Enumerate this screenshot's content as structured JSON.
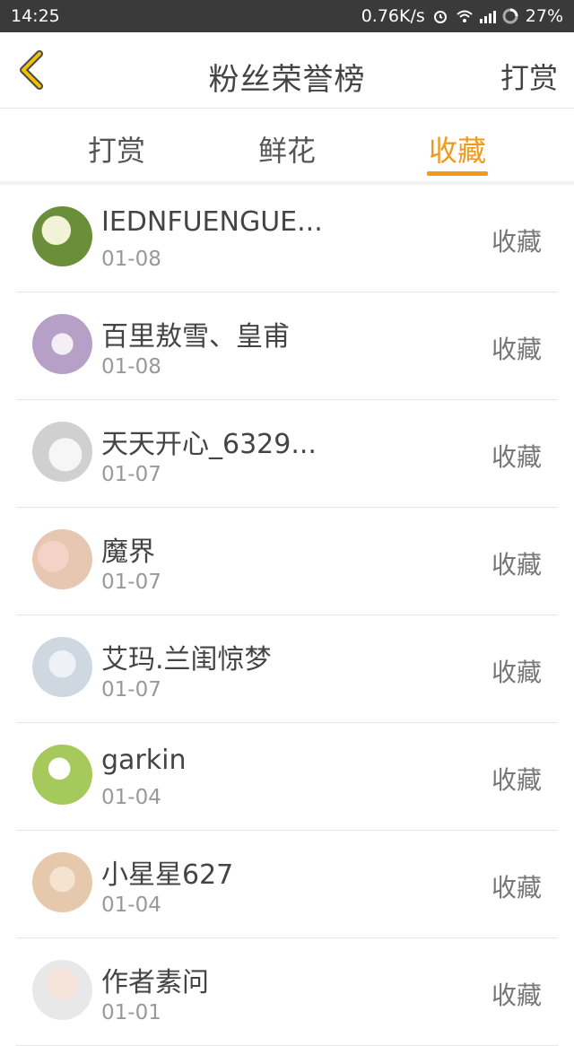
{
  "status": {
    "time": "14:25",
    "speed": "0.76K/s",
    "battery": "27%"
  },
  "header": {
    "title": "粉丝荣誉榜",
    "action": "打赏"
  },
  "tabs": [
    {
      "label": "打赏"
    },
    {
      "label": "鲜花"
    },
    {
      "label": "收藏"
    }
  ],
  "list": [
    {
      "name": "IEDNFUENGUE...",
      "date": "01-08",
      "tag": "收藏",
      "avatar_color": "#6b8e3a"
    },
    {
      "name": "百里敖雪、皇甫",
      "date": "01-08",
      "tag": "收藏",
      "avatar_color": "#b7a0c8"
    },
    {
      "name": "天天开心_6329...",
      "date": "01-07",
      "tag": "收藏",
      "avatar_color": "#d0d0d0"
    },
    {
      "name": "魔界",
      "date": "01-07",
      "tag": "收藏",
      "avatar_color": "#e8c7b2"
    },
    {
      "name": "艾玛.兰闺惊梦",
      "date": "01-07",
      "tag": "收藏",
      "avatar_color": "#cfd7e0"
    },
    {
      "name": "garkin",
      "date": "01-04",
      "tag": "收藏",
      "avatar_color": "#a6c95c"
    },
    {
      "name": "小星星627",
      "date": "01-04",
      "tag": "收藏",
      "avatar_color": "#e6c9ad"
    },
    {
      "name": "作者素问",
      "date": "01-01",
      "tag": "收藏",
      "avatar_color": "#e8e8e8"
    }
  ],
  "colors": {
    "accent": "#f19a1a",
    "text": "#444444",
    "muted": "#999999"
  }
}
